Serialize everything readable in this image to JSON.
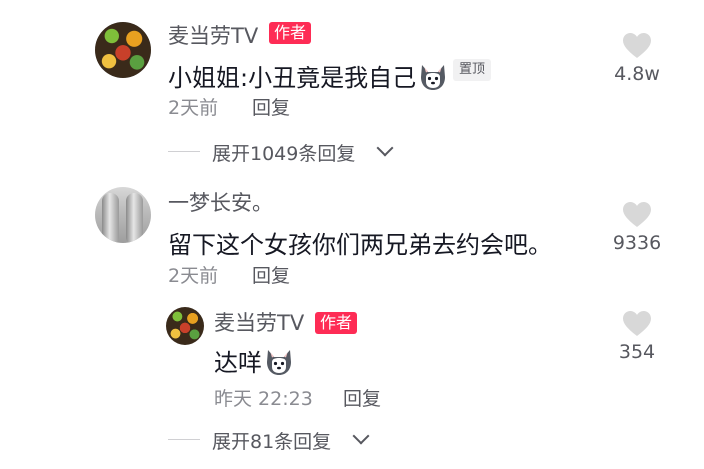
{
  "comments": [
    {
      "author": "麦当劳TV",
      "author_badge": "作者",
      "text": "小姐姐:小丑竟是我自己",
      "emoji": "dog-face-emoji",
      "pin_badge": "置顶",
      "time": "2天前",
      "reply_label": "回复",
      "likes": "4.8w",
      "expand_label": "展开1049条回复"
    },
    {
      "author": "一梦长安。",
      "text": "留下这个女孩你们两兄弟去约会吧。",
      "time": "2天前",
      "reply_label": "回复",
      "likes": "9336",
      "replies": [
        {
          "author": "麦当劳TV",
          "author_badge": "作者",
          "text": "达咩",
          "emoji": "dog-face-emoji",
          "time": "昨天 22:23",
          "reply_label": "回复",
          "likes": "354"
        }
      ],
      "expand_label": "展开81条回复"
    }
  ],
  "icons": {
    "like": "heart-icon",
    "expand": "chevron-down-icon"
  },
  "colors": {
    "badge": "#fe2c55",
    "text": "#161823",
    "muted": "#8a8b91",
    "heart": "#d8d8d8"
  }
}
